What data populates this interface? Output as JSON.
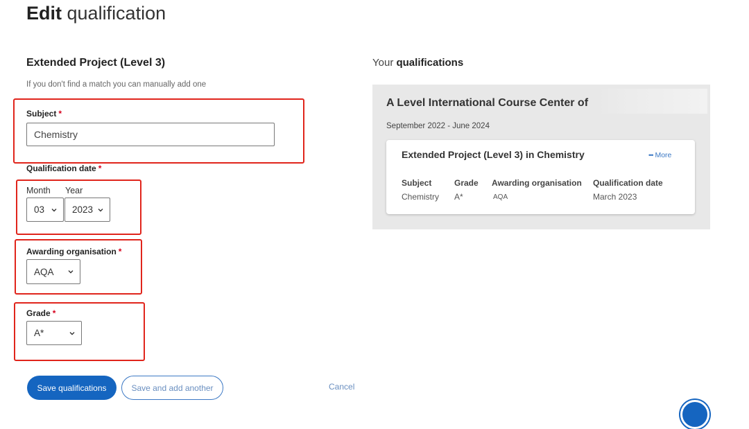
{
  "page": {
    "title_bold": "Edit",
    "title_light": "qualification"
  },
  "form": {
    "section_title": "Extended Project (Level 3)",
    "hint": "If you don't find a match you can manually add one",
    "subject": {
      "label": "Subject",
      "required_mark": "*",
      "value": "Chemistry"
    },
    "qualification_date": {
      "label": "Qualification date",
      "required_mark": "*",
      "month_label": "Month",
      "year_label": "Year",
      "month_value": "03",
      "year_value": "2023"
    },
    "awarding_organisation": {
      "label": "Awarding organisation",
      "required_mark": "*",
      "value": "AQA"
    },
    "grade": {
      "label": "Grade",
      "required_mark": "*",
      "value": "A*"
    },
    "buttons": {
      "save": "Save qualifications",
      "save_add": "Save and add another",
      "cancel": "Cancel"
    }
  },
  "qualifications": {
    "heading_light": "Your",
    "heading_bold": "qualifications",
    "institution": "A Level International Course Center of",
    "period": "September 2022 - June 2024",
    "card": {
      "title": "Extended Project (Level 3) in Chemistry",
      "more_label": "More",
      "columns": {
        "subject": {
          "header": "Subject",
          "value": "Chemistry"
        },
        "grade": {
          "header": "Grade",
          "value": "A*"
        },
        "awarding": {
          "header": "Awarding organisation",
          "value": "AQA"
        },
        "date": {
          "header": "Qualification date",
          "value": "March 2023"
        }
      }
    }
  },
  "colors": {
    "primary": "#1565c0",
    "highlight": "#e0241b",
    "required": "#d6001c",
    "panel_bg": "#e8e8e8"
  },
  "icons": {
    "dropdown": "chevron-down-icon",
    "more": "more-dots-icon",
    "help": "help-icon"
  }
}
